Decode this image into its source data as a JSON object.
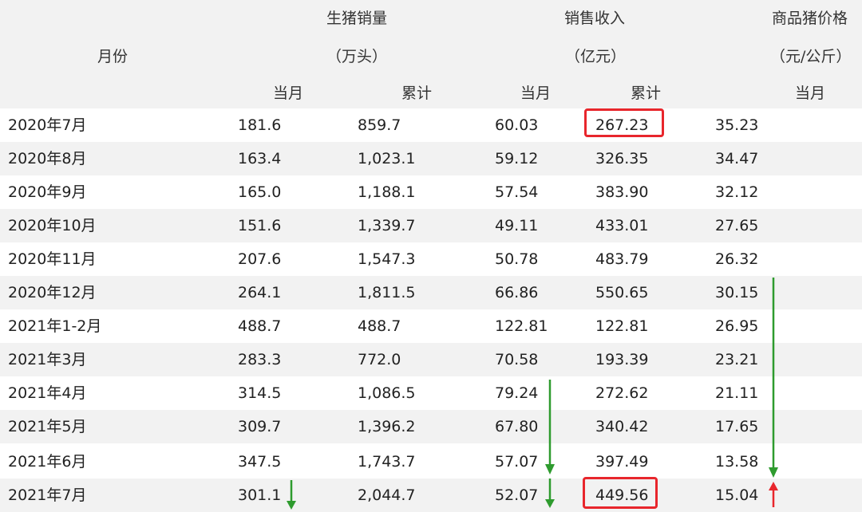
{
  "table": {
    "header": {
      "month": "月份",
      "volume": {
        "title": "生猪销量",
        "unit": "（万头）",
        "current": "当月",
        "cumulative": "累计"
      },
      "revenue": {
        "title": "销售收入",
        "unit": "（亿元）",
        "current": "当月",
        "cumulative": "累计"
      },
      "price": {
        "title": "商品猪价格",
        "unit": "（元/公斤）",
        "current": "当月"
      }
    },
    "rows": [
      {
        "month": "2020年7月",
        "vol_m": "181.6",
        "vol_c": "859.7",
        "rev_m": "60.03",
        "rev_c": "267.23",
        "price": "35.23"
      },
      {
        "month": "2020年8月",
        "vol_m": "163.4",
        "vol_c": "1,023.1",
        "rev_m": "59.12",
        "rev_c": "326.35",
        "price": "34.47"
      },
      {
        "month": "2020年9月",
        "vol_m": "165.0",
        "vol_c": "1,188.1",
        "rev_m": "57.54",
        "rev_c": "383.90",
        "price": "32.12"
      },
      {
        "month": "2020年10月",
        "vol_m": "151.6",
        "vol_c": "1,339.7",
        "rev_m": "49.11",
        "rev_c": "433.01",
        "price": "27.65"
      },
      {
        "month": "2020年11月",
        "vol_m": "207.6",
        "vol_c": "1,547.3",
        "rev_m": "50.78",
        "rev_c": "483.79",
        "price": "26.32"
      },
      {
        "month": "2020年12月",
        "vol_m": "264.1",
        "vol_c": "1,811.5",
        "rev_m": "66.86",
        "rev_c": "550.65",
        "price": "30.15"
      },
      {
        "month": "2021年1-2月",
        "vol_m": "488.7",
        "vol_c": "488.7",
        "rev_m": "122.81",
        "rev_c": "122.81",
        "price": "26.95"
      },
      {
        "month": "2021年3月",
        "vol_m": "283.3",
        "vol_c": "772.0",
        "rev_m": "70.58",
        "rev_c": "193.39",
        "price": "23.21"
      },
      {
        "month": "2021年4月",
        "vol_m": "314.5",
        "vol_c": "1,086.5",
        "rev_m": "79.24",
        "rev_c": "272.62",
        "price": "21.11"
      },
      {
        "month": "2021年5月",
        "vol_m": "309.7",
        "vol_c": "1,396.2",
        "rev_m": "67.80",
        "rev_c": "340.42",
        "price": "17.65"
      },
      {
        "month": "2021年6月",
        "vol_m": "347.5",
        "vol_c": "1,743.7",
        "rev_m": "57.07",
        "rev_c": "397.49",
        "price": "13.58"
      },
      {
        "month": "2021年7月",
        "vol_m": "301.1",
        "vol_c": "2,044.7",
        "rev_m": "52.07",
        "rev_c": "449.56",
        "price": "15.04"
      }
    ]
  },
  "colors": {
    "header_bg": "#f2f2f2",
    "stripe_bg": "#f2f2f2",
    "highlight_box": "#e8262c",
    "arrow_down": "#2e9b2e",
    "arrow_up": "#e8262c"
  },
  "annotations": {
    "highlighted_cells": [
      "rev_c row 2020年7月",
      "rev_c row 2021年7月"
    ],
    "arrows": [
      {
        "name": "vol-down-arrow",
        "direction": "down",
        "color": "green"
      },
      {
        "name": "rev-down-arrow-long",
        "direction": "down",
        "color": "green"
      },
      {
        "name": "rev-down-arrow-short",
        "direction": "down",
        "color": "green"
      },
      {
        "name": "price-down-arrow",
        "direction": "down",
        "color": "green"
      },
      {
        "name": "price-up-arrow",
        "direction": "up",
        "color": "red"
      }
    ]
  }
}
